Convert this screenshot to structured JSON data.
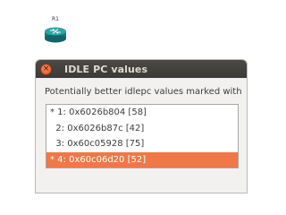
{
  "canvas": {
    "router_label": "R1"
  },
  "dialog": {
    "title": "IDLE PC values",
    "close_glyph": "×",
    "prompt": "Potentially better idlepc values marked with",
    "values": [
      "* 1: 0x6026b804 [58]",
      "  2: 0x6026b87c [42]",
      "  3: 0x60c05928 [75]",
      "* 4: 0x60c06d20 [52]"
    ],
    "selected_index": 3,
    "colors": {
      "titlebar": "#3c3b37",
      "close_button": "#e2531f",
      "selection": "#f07746",
      "router": "#1f8a8e"
    }
  }
}
